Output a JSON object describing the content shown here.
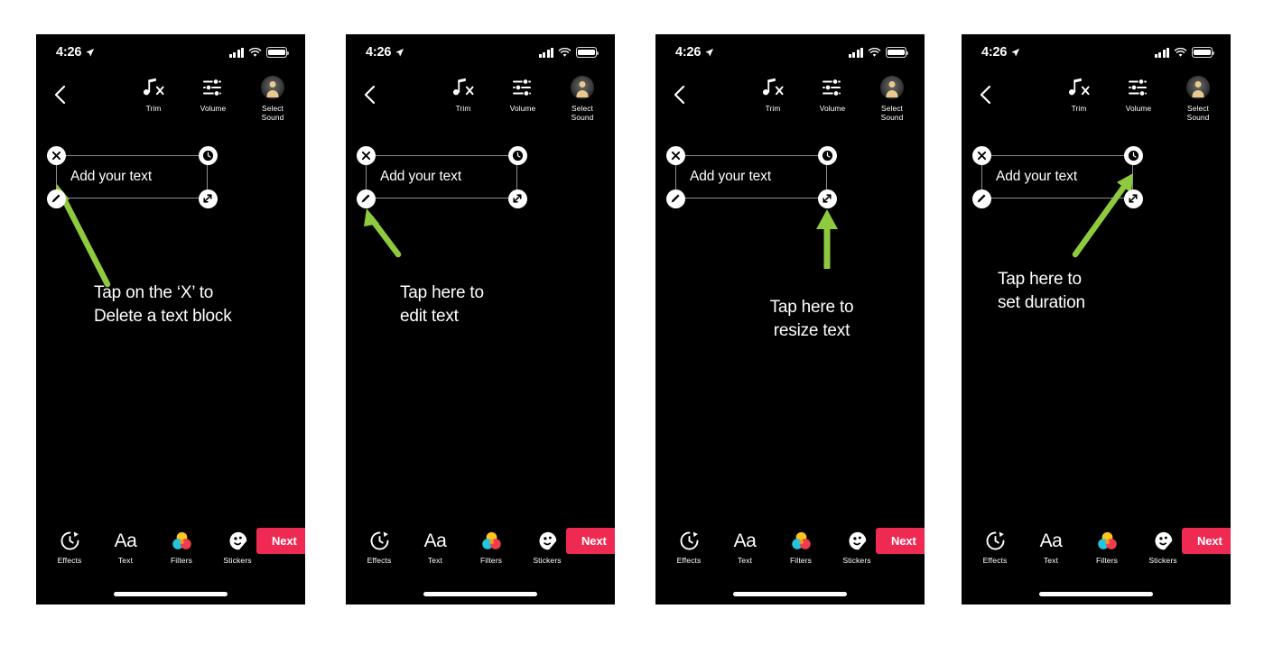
{
  "theme": {
    "phone_bg": "#000000",
    "page_bg": "#ffffff",
    "accent_next": "#ee2a53",
    "arrow_green": "#8fc93f",
    "handle_fill": "#ffffff",
    "frame_stroke": "rgba(255,255,255,0.55)",
    "filters_yellow": "#ffc61e",
    "filters_cyan": "#22c5e0",
    "filters_red": "#ef3d4e",
    "avatar_skin": "#e8c98f"
  },
  "status_bar": {
    "time": "4:26",
    "location_icon": "location-arrow-icon",
    "signal_icon": "cellular-signal-icon",
    "wifi_icon": "wifi-icon",
    "battery_icon": "battery-full-icon"
  },
  "top_nav": {
    "back_icon": "chevron-left-icon",
    "tools": [
      {
        "id": "trim",
        "label": "Trim",
        "icon": "music-note-cut-icon"
      },
      {
        "id": "volume",
        "label": "Volume",
        "icon": "sliders-icon"
      },
      {
        "id": "select-sound",
        "label": "Select\nSound",
        "label_line1": "Select",
        "label_line2": "Sound",
        "icon": "avatar-icon"
      }
    ]
  },
  "text_block": {
    "text": "Add your text",
    "handles": [
      {
        "id": "delete",
        "position": "top-left",
        "icon": "close-x-icon"
      },
      {
        "id": "duration",
        "position": "top-right",
        "icon": "clock-icon"
      },
      {
        "id": "edit",
        "position": "bottom-left",
        "icon": "pencil-icon"
      },
      {
        "id": "resize",
        "position": "bottom-right",
        "icon": "resize-diagonal-icon"
      }
    ]
  },
  "bottom_bar": {
    "tools": [
      {
        "id": "effects",
        "label": "Effects",
        "icon": "timer-clock-icon"
      },
      {
        "id": "text",
        "label": "Text",
        "icon": "aa-text-icon",
        "glyph": "Aa"
      },
      {
        "id": "filters",
        "label": "Filters",
        "icon": "three-circles-icon"
      },
      {
        "id": "stickers",
        "label": "Stickers",
        "icon": "sticker-face-icon"
      }
    ],
    "next_label": "Next",
    "home_indicator": "home-indicator-bar"
  },
  "panels": [
    {
      "id": "panel-delete",
      "annotation_line1": "Tap on the ‘X’ to",
      "annotation_line2": "Delete a text block",
      "arrow_target": "delete-handle",
      "arrow_style": "diagonal-up-left"
    },
    {
      "id": "panel-edit",
      "annotation_line1": "Tap here to",
      "annotation_line2": "edit text",
      "arrow_target": "edit-handle",
      "arrow_style": "diagonal-up-left-short"
    },
    {
      "id": "panel-resize",
      "annotation_line1": "Tap here to",
      "annotation_line2": "resize text",
      "arrow_target": "resize-handle",
      "arrow_style": "vertical-up"
    },
    {
      "id": "panel-duration",
      "annotation_line1": "Tap here to",
      "annotation_line2": "set duration",
      "arrow_target": "duration-handle",
      "arrow_style": "diagonal-up-right"
    }
  ]
}
